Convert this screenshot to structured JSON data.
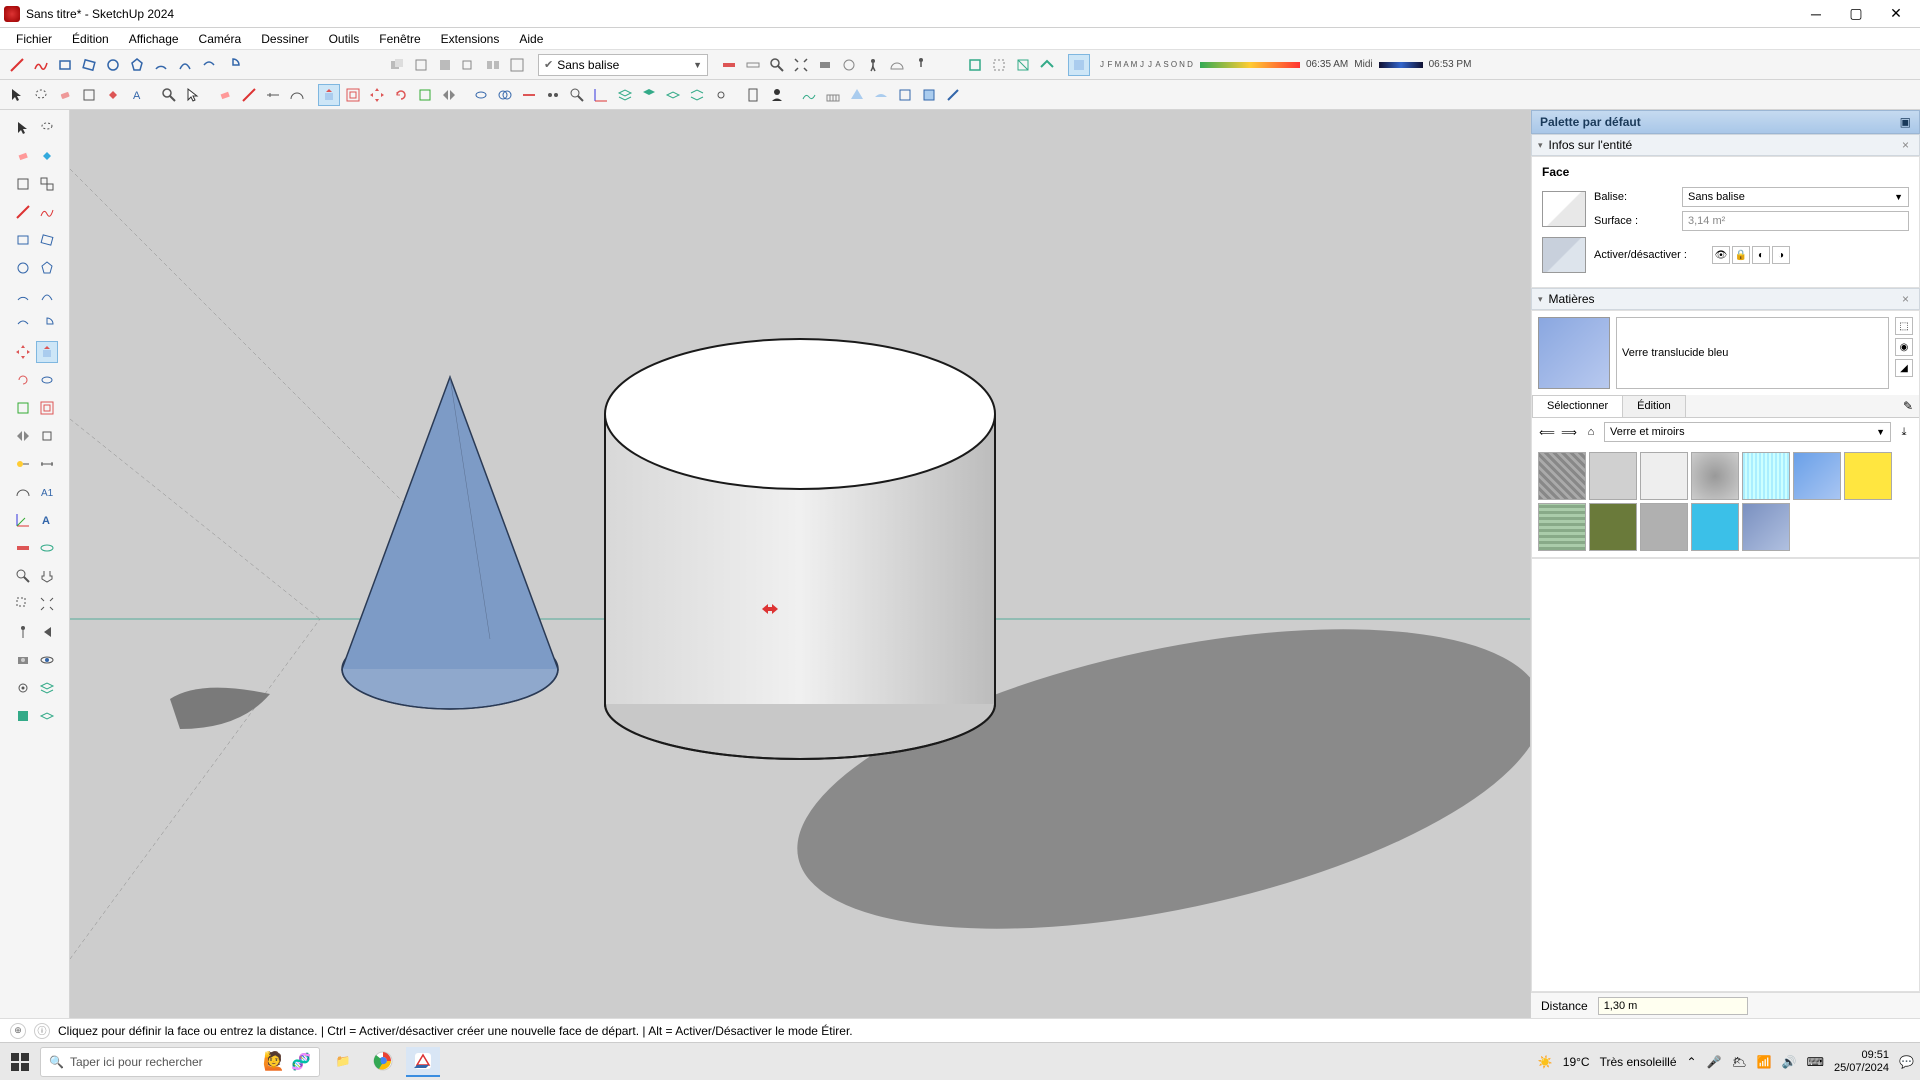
{
  "window": {
    "title": "Sans titre* - SketchUp 2024"
  },
  "menu": [
    "Fichier",
    "Édition",
    "Affichage",
    "Caméra",
    "Dessiner",
    "Outils",
    "Fenêtre",
    "Extensions",
    "Aide"
  ],
  "tag_selector": "Sans balise",
  "shadows": {
    "months": [
      "J",
      "F",
      "M",
      "A",
      "M",
      "J",
      "J",
      "A",
      "S",
      "O",
      "N",
      "D"
    ],
    "time_left": "06:35 AM",
    "time_mid": "Midi",
    "time_right": "06:53 PM"
  },
  "trays": {
    "default_title": "Palette par défaut",
    "entity": {
      "title": "Infos sur l'entité",
      "type": "Face",
      "tag_label": "Balise:",
      "tag_value": "Sans balise",
      "area_label": "Surface :",
      "area_value": "3,14 m²",
      "toggle_label": "Activer/désactiver :"
    },
    "materials": {
      "title": "Matières",
      "current_name": "Verre translucide bleu",
      "tab_select": "Sélectionner",
      "tab_edit": "Édition",
      "category": "Verre et miroirs"
    }
  },
  "vcb": {
    "label": "Distance",
    "value": "1,30 m"
  },
  "statusbar": {
    "hint": "Cliquez pour définir la face ou entrez la distance. | Ctrl = Activer/désactiver créer une nouvelle face de départ. | Alt = Activer/Désactiver le mode Étirer."
  },
  "taskbar": {
    "search_placeholder": "Taper ici pour rechercher",
    "weather_temp": "19°C",
    "weather_desc": "Très ensoleillé",
    "clock_time": "09:51",
    "clock_date": "25/07/2024"
  }
}
